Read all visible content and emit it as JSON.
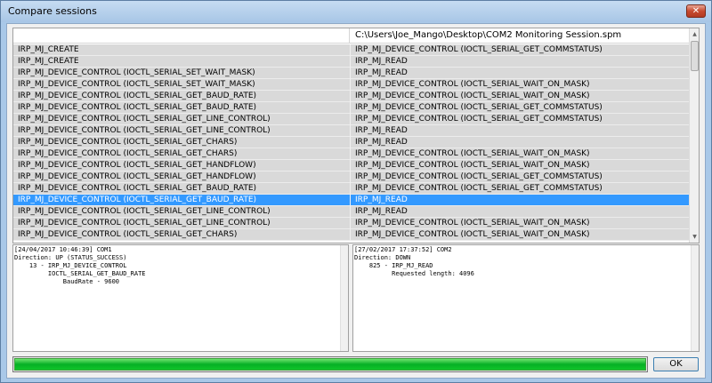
{
  "window": {
    "title": "Compare sessions",
    "close_glyph": "✕"
  },
  "grid": {
    "header_right": "C:\\Users\\Joe_Mango\\Desktop\\COM2 Monitoring Session.spm",
    "rows": [
      {
        "left": "IRP_MJ_CREATE",
        "right": "IRP_MJ_DEVICE_CONTROL (IOCTL_SERIAL_GET_COMMSTATUS)"
      },
      {
        "left": "IRP_MJ_CREATE",
        "right": "IRP_MJ_READ"
      },
      {
        "left": "IRP_MJ_DEVICE_CONTROL (IOCTL_SERIAL_SET_WAIT_MASK)",
        "right": "IRP_MJ_READ"
      },
      {
        "left": "IRP_MJ_DEVICE_CONTROL (IOCTL_SERIAL_SET_WAIT_MASK)",
        "right": "IRP_MJ_DEVICE_CONTROL (IOCTL_SERIAL_WAIT_ON_MASK)"
      },
      {
        "left": "IRP_MJ_DEVICE_CONTROL (IOCTL_SERIAL_GET_BAUD_RATE)",
        "right": "IRP_MJ_DEVICE_CONTROL (IOCTL_SERIAL_WAIT_ON_MASK)"
      },
      {
        "left": "IRP_MJ_DEVICE_CONTROL (IOCTL_SERIAL_GET_BAUD_RATE)",
        "right": "IRP_MJ_DEVICE_CONTROL (IOCTL_SERIAL_GET_COMMSTATUS)"
      },
      {
        "left": "IRP_MJ_DEVICE_CONTROL (IOCTL_SERIAL_GET_LINE_CONTROL)",
        "right": "IRP_MJ_DEVICE_CONTROL (IOCTL_SERIAL_GET_COMMSTATUS)"
      },
      {
        "left": "IRP_MJ_DEVICE_CONTROL (IOCTL_SERIAL_GET_LINE_CONTROL)",
        "right": "IRP_MJ_READ"
      },
      {
        "left": "IRP_MJ_DEVICE_CONTROL (IOCTL_SERIAL_GET_CHARS)",
        "right": "IRP_MJ_READ"
      },
      {
        "left": "IRP_MJ_DEVICE_CONTROL (IOCTL_SERIAL_GET_CHARS)",
        "right": "IRP_MJ_DEVICE_CONTROL (IOCTL_SERIAL_WAIT_ON_MASK)"
      },
      {
        "left": "IRP_MJ_DEVICE_CONTROL (IOCTL_SERIAL_GET_HANDFLOW)",
        "right": "IRP_MJ_DEVICE_CONTROL (IOCTL_SERIAL_WAIT_ON_MASK)"
      },
      {
        "left": "IRP_MJ_DEVICE_CONTROL (IOCTL_SERIAL_GET_HANDFLOW)",
        "right": "IRP_MJ_DEVICE_CONTROL (IOCTL_SERIAL_GET_COMMSTATUS)"
      },
      {
        "left": "IRP_MJ_DEVICE_CONTROL (IOCTL_SERIAL_GET_BAUD_RATE)",
        "right": "IRP_MJ_DEVICE_CONTROL (IOCTL_SERIAL_GET_COMMSTATUS)"
      },
      {
        "left": "IRP_MJ_DEVICE_CONTROL (IOCTL_SERIAL_GET_BAUD_RATE)",
        "right": "IRP_MJ_READ",
        "selected": true
      },
      {
        "left": "IRP_MJ_DEVICE_CONTROL (IOCTL_SERIAL_GET_LINE_CONTROL)",
        "right": "IRP_MJ_READ"
      },
      {
        "left": "IRP_MJ_DEVICE_CONTROL (IOCTL_SERIAL_GET_LINE_CONTROL)",
        "right": "IRP_MJ_DEVICE_CONTROL (IOCTL_SERIAL_WAIT_ON_MASK)"
      },
      {
        "left": "IRP_MJ_DEVICE_CONTROL (IOCTL_SERIAL_GET_CHARS)",
        "right": "IRP_MJ_DEVICE_CONTROL (IOCTL_SERIAL_WAIT_ON_MASK)"
      }
    ]
  },
  "detail_left": {
    "text": "[24/04/2017 10:46:39] COM1\nDirection: UP (STATUS_SUCCESS)\n    13 - IRP_MJ_DEVICE_CONTROL\n         IOCTL_SERIAL_GET_BAUD_RATE\n             BaudRate - 9600"
  },
  "detail_right": {
    "text": "[27/02/2017 17:37:52] COM2\nDirection: DOWN\n    825 - IRP_MJ_READ\n          Requested length: 4096"
  },
  "progress": {
    "value_percent": 100
  },
  "buttons": {
    "ok": "OK"
  },
  "colors": {
    "selected_row": "#3399ff",
    "progress_green": "#06b025"
  }
}
